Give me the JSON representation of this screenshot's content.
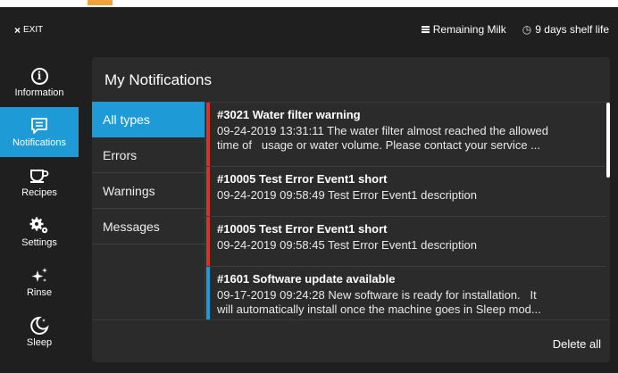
{
  "topbar": {
    "exit_label": "EXIT",
    "remaining_label": "Remaining Milk",
    "shelf_life": "9 days shelf life"
  },
  "sidebar": {
    "items": [
      {
        "label": "Information",
        "icon": "info-icon"
      },
      {
        "label": "Notifications",
        "icon": "notifications-icon",
        "active": true
      },
      {
        "label": "Recipes",
        "icon": "cup-icon"
      },
      {
        "label": "Settings",
        "icon": "gears-icon"
      },
      {
        "label": "Rinse",
        "icon": "sparkle-icon"
      },
      {
        "label": "Sleep",
        "icon": "moon-icon"
      }
    ]
  },
  "panel": {
    "title": "My Notifications",
    "filters": [
      "All types",
      "Errors",
      "Warnings",
      "Messages"
    ],
    "active_filter": "All types",
    "notifications": [
      {
        "title": "#3021 Water filter warning",
        "desc": "09-24-2019 13:31:11 The water filter almost reached the allowed\ntime of   usage or water volume. Please contact your service ...",
        "color": "#d9322a"
      },
      {
        "title": "#10005 Test Error Event1 short",
        "desc": "09-24-2019 09:58:49 Test Error Event1 description",
        "color": "#d9322a"
      },
      {
        "title": "#10005 Test Error Event1 short",
        "desc": "09-24-2019 09:58:45 Test Error Event1 description",
        "color": "#d9322a"
      },
      {
        "title": "#1601 Software update available",
        "desc": "09-17-2019 09:24:28 New software is ready for installation.   It\nwill automatically install once the machine goes in Sleep mod...",
        "color": "#1e9ad6"
      }
    ],
    "delete_all_label": "Delete all"
  },
  "colors": {
    "accent": "#1e9ad6",
    "error": "#d9322a",
    "orange": "#f2a23a"
  }
}
